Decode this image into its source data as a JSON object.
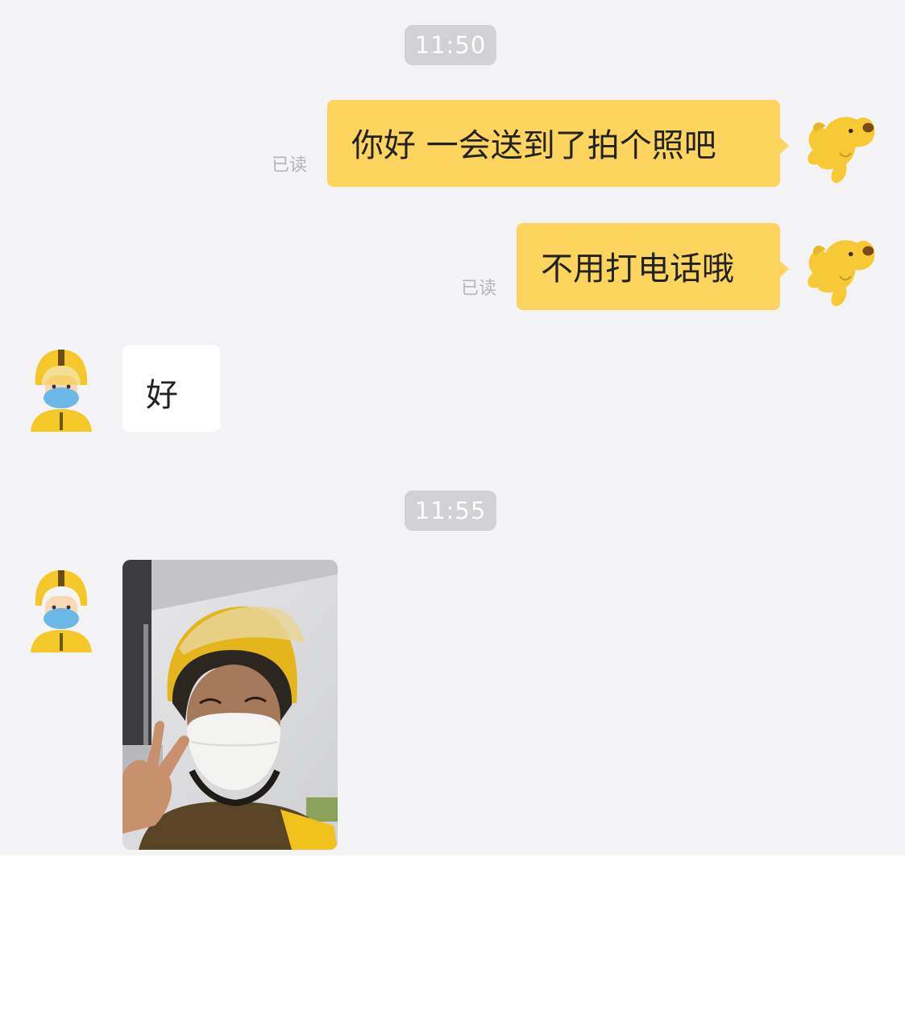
{
  "colors": {
    "chat_background": "#f4f4f6",
    "outgoing_bubble": "#fcd45e",
    "incoming_bubble": "#ffffff",
    "time_pill": "#d2d2d4",
    "read_receipt_text": "#b5b5b8",
    "courier_helmet": "#f5c829",
    "mask": "#6bb8e6"
  },
  "timestamps": [
    "11:50",
    "11:55"
  ],
  "messages": [
    {
      "direction": "outgoing",
      "text": "你好 一会送到了拍个照吧",
      "status": "已读",
      "avatar": "yellow-dog-icon"
    },
    {
      "direction": "outgoing",
      "text": "不用打电话哦",
      "status": "已读",
      "avatar": "yellow-dog-icon"
    },
    {
      "direction": "incoming",
      "text": "好",
      "avatar": "courier-avatar-icon"
    },
    {
      "direction": "incoming",
      "type": "image",
      "content": "photo",
      "avatar": "courier-avatar-icon"
    }
  ]
}
